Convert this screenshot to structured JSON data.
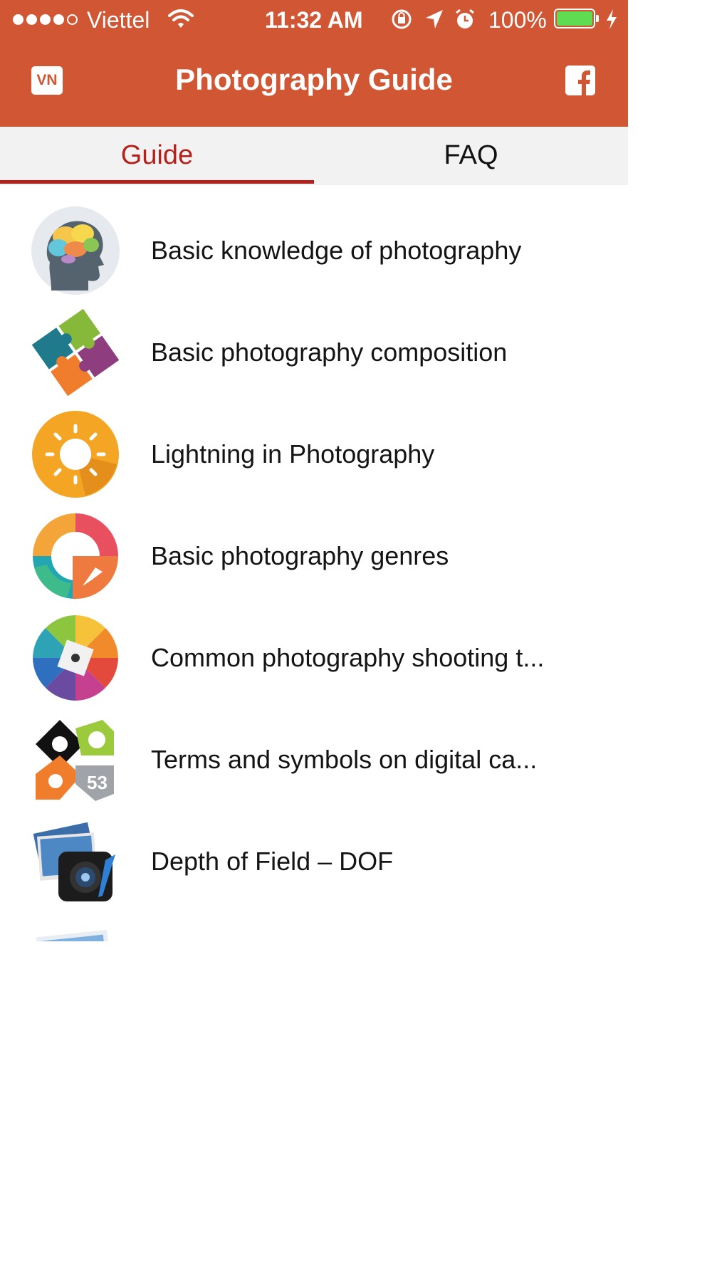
{
  "status_bar": {
    "carrier": "Viettel",
    "time": "11:32 AM",
    "battery_percent": "100%",
    "battery_level": 1.0,
    "signal_bars": 4,
    "signal_total": 5
  },
  "header": {
    "title": "Photography Guide",
    "language_button": "VN",
    "facebook_icon": "facebook-icon",
    "color": "#d05634"
  },
  "tabs": [
    {
      "label": "Guide",
      "active": true
    },
    {
      "label": "FAQ",
      "active": false
    }
  ],
  "accent_color": "#b2211b",
  "guide_items": [
    {
      "label": "Basic knowledge of photography",
      "icon": "brain-head-icon"
    },
    {
      "label": "Basic photography composition",
      "icon": "puzzle-icon"
    },
    {
      "label": "Lightning in Photography",
      "icon": "sun-icon"
    },
    {
      "label": "Basic photography genres",
      "icon": "genres-bird-icon"
    },
    {
      "label": "Common photography shooting t...",
      "icon": "color-wheel-icon"
    },
    {
      "label": "Terms and symbols on digital ca...",
      "icon": "camera-symbols-icon"
    },
    {
      "label": "Depth of Field – DOF",
      "icon": "camera-photos-icon"
    },
    {
      "label": "",
      "icon": "photos-icon"
    }
  ]
}
